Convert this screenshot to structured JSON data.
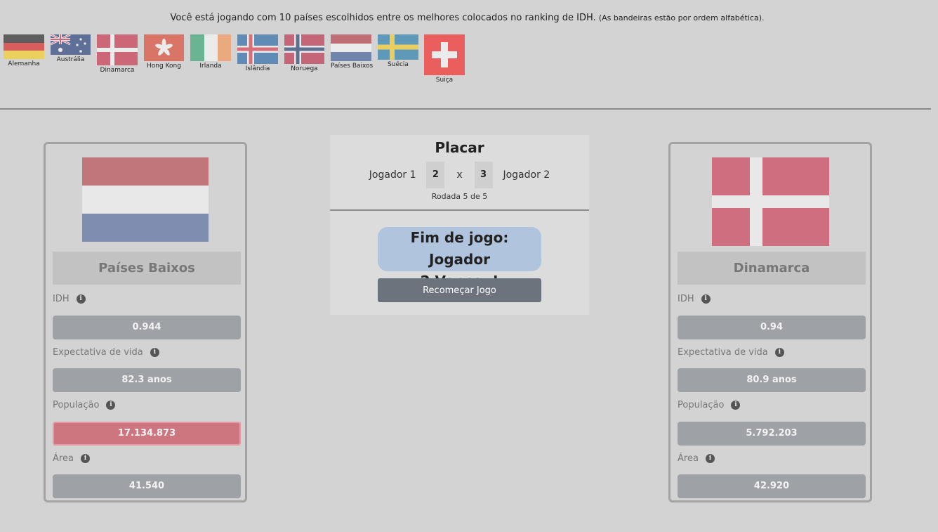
{
  "intro": {
    "text": "Você está jogando com 10 países escolhidos entre os melhores colocados no ranking de IDH.",
    "note": "(As bandeiras estão por ordem alfabética)."
  },
  "flags": [
    {
      "name": "Alemanha",
      "icon": "germany-flag-icon"
    },
    {
      "name": "Austrália",
      "icon": "australia-flag-icon"
    },
    {
      "name": "Dinamarca",
      "icon": "denmark-flag-icon"
    },
    {
      "name": "Hong Kong",
      "icon": "hong-kong-flag-icon"
    },
    {
      "name": "Irlanda",
      "icon": "ireland-flag-icon"
    },
    {
      "name": "Islândia",
      "icon": "iceland-flag-icon"
    },
    {
      "name": "Noruega",
      "icon": "norway-flag-icon"
    },
    {
      "name": "Países Baixos",
      "icon": "netherlands-flag-icon"
    },
    {
      "name": "Suécia",
      "icon": "sweden-flag-icon"
    },
    {
      "name": "Suiça",
      "icon": "switzerland-flag-icon"
    }
  ],
  "player1": {
    "country": "Países Baixos",
    "flag_icon": "netherlands-flag-icon",
    "stats": [
      {
        "label": "IDH",
        "value": "0.944"
      },
      {
        "label": "Expectativa de vida",
        "value": "82.3 anos"
      },
      {
        "label": "População",
        "value": "17.134.873",
        "highlighted": true
      },
      {
        "label": "Área",
        "value": "41.540"
      }
    ]
  },
  "player2": {
    "country": "Dinamarca",
    "flag_icon": "denmark-flag-icon",
    "stats": [
      {
        "label": "IDH",
        "value": "0.94"
      },
      {
        "label": "Expectativa de vida",
        "value": "80.9 anos"
      },
      {
        "label": "População",
        "value": "5.792.203"
      },
      {
        "label": "Área",
        "value": "42.920"
      }
    ]
  },
  "scoreboard": {
    "title": "Placar",
    "player1_label": "Jogador 1",
    "player1_score": "2",
    "separator": "x",
    "player2_score": "3",
    "player2_label": "Jogador 2",
    "round": "Rodada 5 de 5",
    "result_line1": "Fim de jogo: Jogador",
    "result_line2": "2 Venceu!",
    "restart_label": "Recomeçar Jogo"
  },
  "info_icon_glyph": "i",
  "colors": {
    "background": "#d3d3d3",
    "stat_button": "#9ea2a7",
    "winning_stat": "#cd767f",
    "result_badge": "#b0c4de",
    "restart_button": "#6c737c"
  }
}
